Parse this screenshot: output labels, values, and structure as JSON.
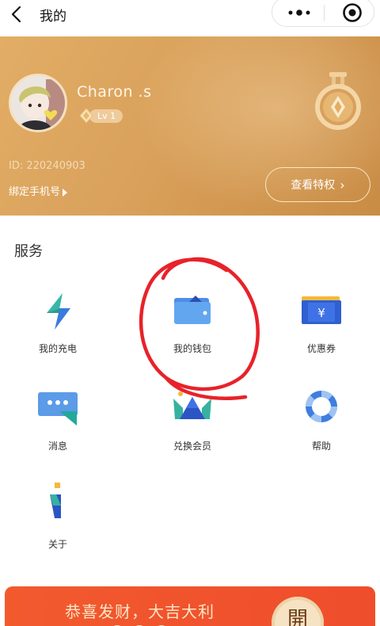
{
  "nav": {
    "title": "我的"
  },
  "profile": {
    "username": "Charon .s",
    "level": "Lv 1",
    "user_id": "ID: 220240903",
    "bind_phone_label": "绑定手机号",
    "privilege_button": "查看特权",
    "colors": {
      "gradient_start": "#e2ad66",
      "gradient_end": "#c98c45"
    }
  },
  "services": {
    "title": "服务",
    "items": [
      {
        "label": "我的充电",
        "icon": "lightning-icon"
      },
      {
        "label": "我的钱包",
        "icon": "wallet-icon"
      },
      {
        "label": "优惠券",
        "icon": "coupon-icon"
      },
      {
        "label": "消息",
        "icon": "message-icon"
      },
      {
        "label": "兑换会员",
        "icon": "crown-icon"
      },
      {
        "label": "帮助",
        "icon": "lifebuoy-icon"
      },
      {
        "label": "关于",
        "icon": "info-icon"
      }
    ]
  },
  "banner": {
    "text": "恭喜发财，大吉大利",
    "coin_char": "開",
    "colors": {
      "background": "#f25a2e",
      "text": "#fde7c5"
    }
  },
  "annotation": {
    "color": "#e8222a"
  }
}
